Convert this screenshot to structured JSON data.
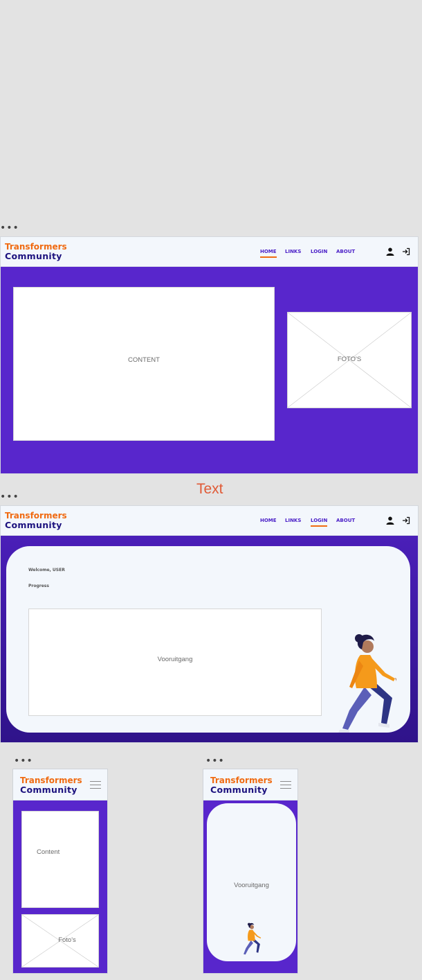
{
  "brand": {
    "line1": "Transformers",
    "line2": "Community"
  },
  "nav": {
    "home": "HOME",
    "links": "LINKS",
    "login": "LOGIN",
    "about": "ABOUT"
  },
  "overflow_dots": "•••",
  "desktop_home": {
    "content_label": "CONTENT",
    "photos_label": "FOTO'S",
    "active_nav": "HOME"
  },
  "between_text": "Text",
  "desktop_login": {
    "welcome": "Welcome, USER",
    "progress_heading": "Progress",
    "progress_box_label": "Vooruitgang",
    "active_nav": "LOGIN"
  },
  "mobile_home": {
    "content_label": "Content",
    "photos_label": "Foto's"
  },
  "mobile_login": {
    "progress_label": "Vooruitgang"
  },
  "colors": {
    "accent_orange": "#f06b12",
    "brand_purple": "#5826cc",
    "dark_navy": "#1d137f",
    "card_bg": "#f3f7fc"
  },
  "icons": [
    "user-icon",
    "login-icon",
    "hamburger-icon",
    "person-illustration",
    "placeholder-x-icon"
  ]
}
